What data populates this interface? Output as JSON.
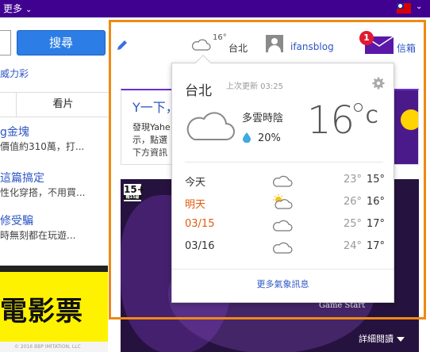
{
  "topbar": {
    "more_label": "更多",
    "chevron": "⌄"
  },
  "search": {
    "button_label": "搜尋",
    "placeholder": ""
  },
  "left": {
    "link_weili": "威力彩",
    "tab_film": "看片",
    "news": [
      {
        "title": "g金塊",
        "desc": "價值約310萬，打..."
      },
      {
        "title": "這篇搞定",
        "desc": "性化穿搭，不用買..."
      },
      {
        "title": "修受騙",
        "desc": "時無刻都在玩遊..."
      }
    ],
    "movie_ad_text": "電影票",
    "movie_ad_footer": "© 2016 BBP IMITATION, LLC"
  },
  "header": {
    "weather_temp": "16°",
    "weather_city": "台北",
    "username": "ifansblog",
    "mail_badge": "1",
    "mail_label": "信箱"
  },
  "promo": {
    "title": "Y一下，",
    "lines": [
      "發現Yahe",
      "示，點選",
      "下方資訊"
    ]
  },
  "game_ad": {
    "rating": "15+",
    "rating_sub": "輔15級",
    "start_label": "Game Start",
    "detail_label": "詳細閱讀"
  },
  "weather": {
    "city": "台北",
    "updated": "上次更新 03:25",
    "condition": "多雲時陰",
    "rain_chance": "20%",
    "temp": "16",
    "unit": "C",
    "forecast": [
      {
        "day": "今天",
        "icon": "cloud",
        "hi": "23°",
        "lo": "15°",
        "highlight": false
      },
      {
        "day": "明天",
        "icon": "sun-cloud",
        "hi": "26°",
        "lo": "16°",
        "highlight": true
      },
      {
        "day": "03/15",
        "icon": "cloud",
        "hi": "25°",
        "lo": "17°",
        "highlight": true
      },
      {
        "day": "03/16",
        "icon": "cloud",
        "hi": "24°",
        "lo": "17°",
        "highlight": false
      }
    ],
    "more_link": "更多氣象訊息"
  },
  "colors": {
    "topbar": "#400090",
    "accent_blue": "#2d55c4",
    "highlight_border": "#ee8a12",
    "forecast_highlight": "#e05a10"
  }
}
